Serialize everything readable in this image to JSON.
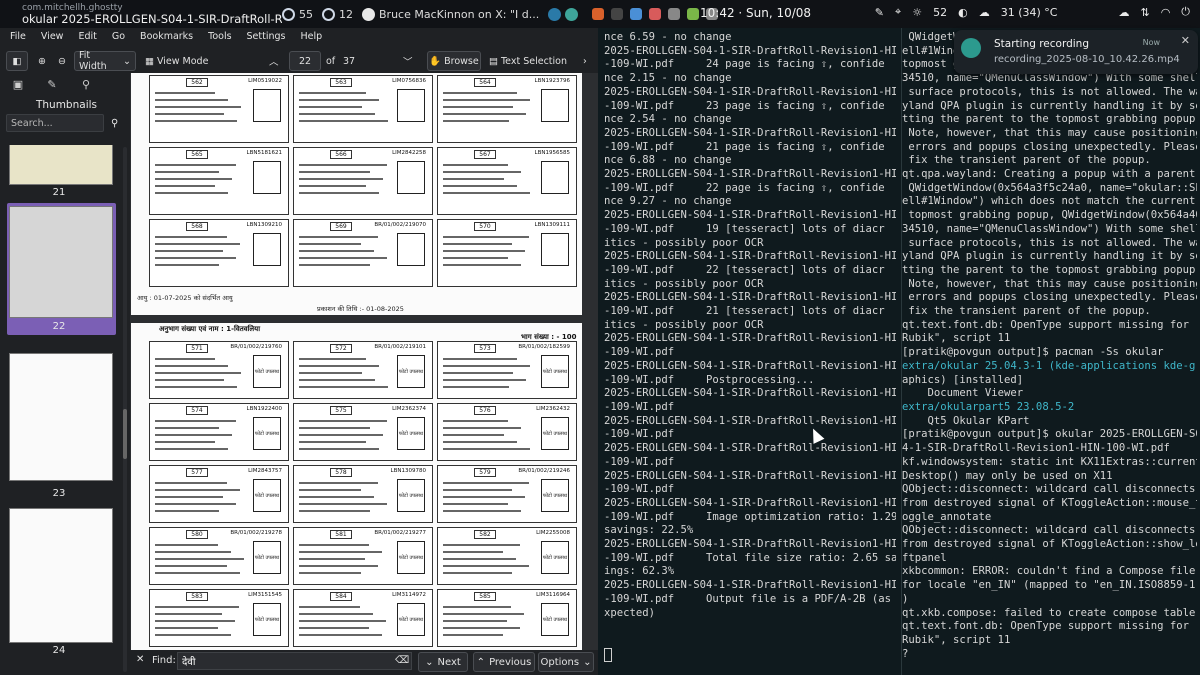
{
  "topbar": {
    "app_id": "com.mitchellh.ghostty",
    "window_title": "okular 2025-EROLLGEN-S04-1-SIR-DraftRoll-Revisi...",
    "badge1": "55",
    "badge2": "12",
    "tweet": "Bruce MacKinnon on X: \"I d...",
    "clock": "10:42 · Sun, 10/08",
    "brightness": "52",
    "weather": "31 (34) °C"
  },
  "okular": {
    "menus": [
      "File",
      "View",
      "Edit",
      "Go",
      "Bookmarks",
      "Tools",
      "Settings",
      "Help"
    ],
    "zoom": "Fit Width",
    "view_mode": "View Mode",
    "page_current": "22",
    "page_of": "of",
    "page_total": "37",
    "browse": "Browse",
    "text_selection": "Text Selection",
    "sidebar_title": "Thumbnails",
    "sidebar_search_placeholder": "Search...",
    "thumb_labels": [
      "21",
      "22",
      "23",
      "24"
    ],
    "find_label": "Find:",
    "find_value": "देवी",
    "next": "Next",
    "previous": "Previous",
    "options": "Options"
  },
  "page_top": {
    "cards": [
      {
        "no": "562",
        "code": "LIM0519022"
      },
      {
        "no": "563",
        "code": "LIM0756836"
      },
      {
        "no": "564",
        "code": "LBN1923796"
      },
      {
        "no": "565",
        "code": "LBN5181621"
      },
      {
        "no": "566",
        "code": "LIM2842258"
      },
      {
        "no": "567",
        "code": "LBN1956585"
      },
      {
        "no": "568",
        "code": "LBN1309210"
      },
      {
        "no": "569",
        "code": "BR/01/002/219070"
      },
      {
        "no": "570",
        "code": "LBN1309111"
      }
    ],
    "footer_left": "आयु : 01-07-2025 को संदर्भित आयु",
    "footer_center": "प्रकाशन की तिथि :- 01-08-2025"
  },
  "page_bottom": {
    "header": "अनुभाग संख्या एवं नाम : 1-वितवलिया",
    "header_right": "भाग संख्या : - 100",
    "cards": [
      {
        "no": "571",
        "code": "BR/01/002/219760"
      },
      {
        "no": "572",
        "code": "BR/01/002/219101"
      },
      {
        "no": "573",
        "code": "BR/01/002/182599"
      },
      {
        "no": "574",
        "code": "LBN1922400"
      },
      {
        "no": "575",
        "code": "LIM2362374"
      },
      {
        "no": "576",
        "code": "LIM2362432"
      },
      {
        "no": "577",
        "code": "LIM2843757"
      },
      {
        "no": "578",
        "code": "LBN1309780"
      },
      {
        "no": "579",
        "code": "BR/01/002/219246"
      },
      {
        "no": "580",
        "code": "BR/01/002/219278"
      },
      {
        "no": "581",
        "code": "BR/01/002/219277"
      },
      {
        "no": "582",
        "code": "LIM2255008"
      },
      {
        "no": "583",
        "code": "LIM3151545"
      },
      {
        "no": "584",
        "code": "LIM3114972"
      },
      {
        "no": "585",
        "code": "LIM3116964"
      }
    ],
    "photo_label": "फोटो उपलब्ध"
  },
  "terminal_left": [
    "nce 6.59 - no change",
    "2025-EROLLGEN-S04-1-SIR-DraftRoll-Revision1-HIN",
    "-109-WI.pdf     24 page is facing ⇧, confide",
    "nce 2.15 - no change",
    "2025-EROLLGEN-S04-1-SIR-DraftRoll-Revision1-HIN",
    "-109-WI.pdf     23 page is facing ⇧, confide",
    "nce 2.54 - no change",
    "2025-EROLLGEN-S04-1-SIR-DraftRoll-Revision1-HIN",
    "-109-WI.pdf     21 page is facing ⇧, confide",
    "nce 6.88 - no change",
    "2025-EROLLGEN-S04-1-SIR-DraftRoll-Revision1-HIN",
    "-109-WI.pdf     22 page is facing ⇧, confide",
    "nce 9.27 - no change",
    "2025-EROLLGEN-S04-1-SIR-DraftRoll-Revision1-HIN",
    "-109-WI.pdf     19 [tesseract] lots of diacr",
    "itics - possibly poor OCR",
    "2025-EROLLGEN-S04-1-SIR-DraftRoll-Revision1-HIN",
    "-109-WI.pdf     22 [tesseract] lots of diacr",
    "itics - possibly poor OCR",
    "2025-EROLLGEN-S04-1-SIR-DraftRoll-Revision1-HIN",
    "-109-WI.pdf     21 [tesseract] lots of diacr",
    "itics - possibly poor OCR",
    "2025-EROLLGEN-S04-1-SIR-DraftRoll-Revision1-HIN",
    "-109-WI.pdf",
    "2025-EROLLGEN-S04-1-SIR-DraftRoll-Revision1-HIN",
    "-109-WI.pdf     Postprocessing...",
    "2025-EROLLGEN-S04-1-SIR-DraftRoll-Revision1-HIN",
    "-109-WI.pdf",
    "2025-EROLLGEN-S04-1-SIR-DraftRoll-Revision1-HIN",
    "-109-WI.pdf",
    "2025-EROLLGEN-S04-1-SIR-DraftRoll-Revision1-HIN",
    "-109-WI.pdf",
    "2025-EROLLGEN-S04-1-SIR-DraftRoll-Revision1-HIN",
    "-109-WI.pdf",
    "2025-EROLLGEN-S04-1-SIR-DraftRoll-Revision1-HIN",
    "-109-WI.pdf     Image optimization ratio: 1.29",
    "savings: 22.5%",
    "2025-EROLLGEN-S04-1-SIR-DraftRoll-Revision1-HIN",
    "-109-WI.pdf     Total file size ratio: 2.65 sav",
    "ings: 62.3%",
    "2025-EROLLGEN-S04-1-SIR-DraftRoll-Revision1-HIN",
    "-109-WI.pdf     Output file is a PDF/A-2B (as e",
    "xpected)"
  ],
  "terminal_right": [
    " QWidgetWi",
    "ell#1Wind",
    "topmost g",
    "34510, name=\"QMenuClassWindow\") With some shell",
    " surface protocols, this is not allowed. The wa",
    "yland QPA plugin is currently handling it by se",
    "tting the parent to the topmost grabbing popup.",
    " Note, however, that this may cause positioning",
    " errors and popups closing unexpectedly. Please",
    " fix the transient parent of the popup.",
    "qt.qpa.wayland: Creating a popup with a parent,",
    " QWidgetWindow(0x564a3f5c24a0, name=\"okular::Sh",
    "ell#1Window\") which does not match the current",
    " topmost grabbing popup, QWidgetWindow(0x564a403",
    "34510, name=\"QMenuClassWindow\") With some shell",
    " surface protocols, this is not allowed. The wa",
    "yland QPA plugin is currently handling it by se",
    "tting the parent to the topmost grabbing popup.",
    " Note, however, that this may cause positioning",
    " errors and popups closing unexpectedly. Please",
    " fix the transient parent of the popup.",
    "qt.text.font.db: OpenType support missing for \"",
    "Rubik\", script 11",
    "[pratik@povgun output]$ pacman -Ss okular",
    "extra/okular 25.04.3-1 (kde-applications kde-gr",
    "aphics) [installed]",
    "    Document Viewer",
    "extra/okularpart5 23.08.5-2",
    "    Qt5 Okular KPart",
    "[pratik@povgun output]$ okular 2025-EROLLGEN-S0",
    "4-1-SIR-DraftRoll-Revision1-HIN-100-WI.pdf",
    "kf.windowsystem: static int KX11Extras::current",
    "Desktop() may only be used on X11",
    "QObject::disconnect: wildcard call disconnects",
    "from destroyed signal of KToggleAction::mouse_t",
    "oggle_annotate",
    "QObject::disconnect: wildcard call disconnects",
    "from destroyed signal of KToggleAction::show_le",
    "ftpanel",
    "xkbcommon: ERROR: couldn't find a Compose file",
    "for locale \"en_IN\" (mapped to \"en_IN.ISO8859-1\"",
    ")",
    "qt.xkb.compose: failed to create compose table",
    "qt.text.font.db: OpenType support missing for \"",
    "Rubik\", script 11",
    "?"
  ],
  "notification": {
    "title": "Starting recording",
    "body": "recording_2025-08-10_10.42.26.mp4",
    "when": "Now"
  }
}
